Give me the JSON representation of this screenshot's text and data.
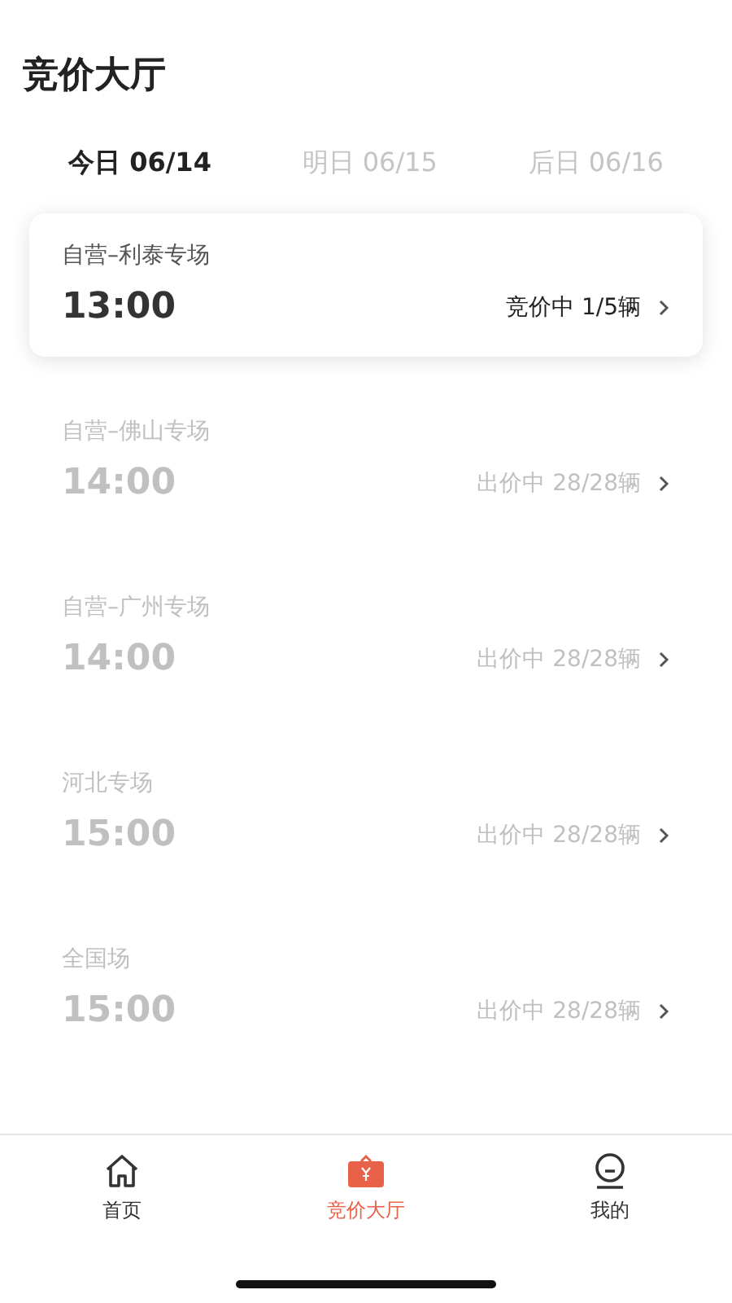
{
  "title": "竞价大厅",
  "tabs": [
    {
      "label": "今日 06/14",
      "selected": true
    },
    {
      "label": "明日 06/15",
      "selected": false
    },
    {
      "label": "后日 06/16",
      "selected": false
    }
  ],
  "sessions": [
    {
      "name": "自营–利泰专场",
      "time": "13:00",
      "status": "竞价中 1/5辆",
      "active": true
    },
    {
      "name": "自营–佛山专场",
      "time": "14:00",
      "status": "出价中 28/28辆",
      "active": false
    },
    {
      "name": "自营–广州专场",
      "time": "14:00",
      "status": "出价中 28/28辆",
      "active": false
    },
    {
      "name": "河北专场",
      "time": "15:00",
      "status": "出价中 28/28辆",
      "active": false
    },
    {
      "name": "全国场",
      "time": "15:00",
      "status": "出价中 28/28辆",
      "active": false
    }
  ],
  "nav": [
    {
      "kind": "home",
      "label": "首页",
      "selected": false
    },
    {
      "kind": "auction",
      "label": "竞价大厅",
      "selected": true
    },
    {
      "kind": "profile",
      "label": "我的",
      "selected": false
    }
  ]
}
